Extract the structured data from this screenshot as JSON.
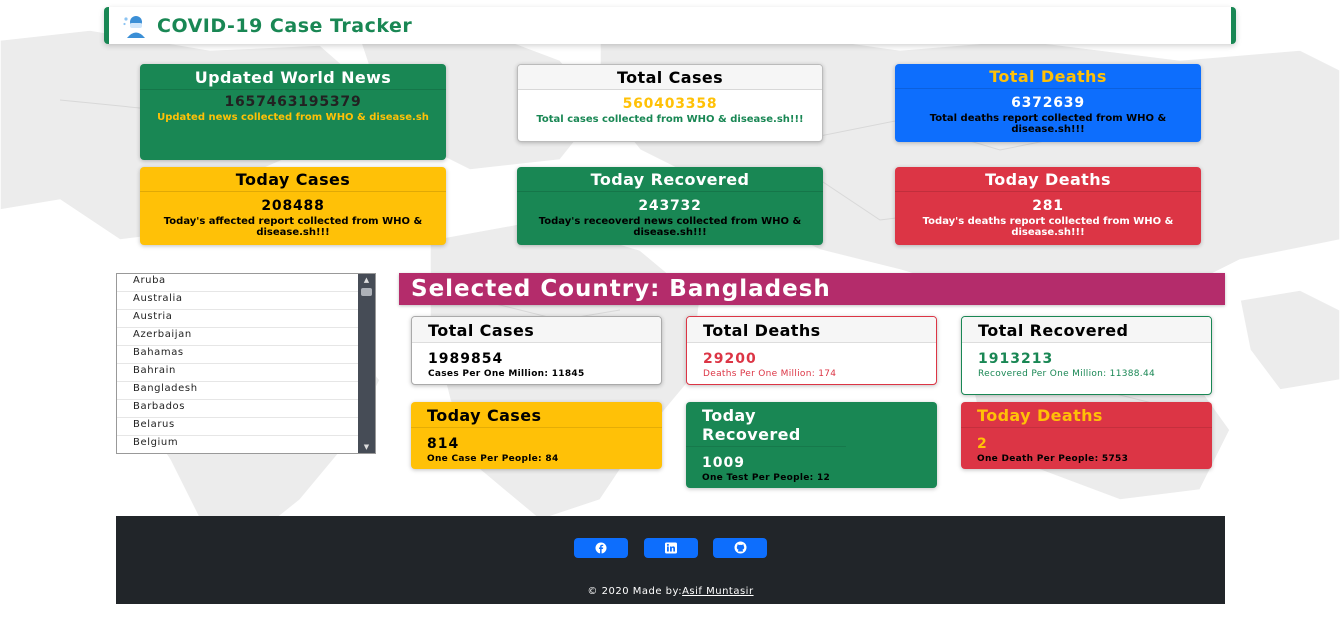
{
  "app": {
    "title": "COVID-19 Case Tracker",
    "accent": "#198754"
  },
  "world": {
    "updated": {
      "title": "Updated World News",
      "value": "1657463195379",
      "note": "Updated news collected from WHO & disease.sh"
    },
    "total_cases": {
      "title": "Total Cases",
      "value": "560403358",
      "note": "Total cases collected from WHO & disease.sh!!!"
    },
    "total_deaths": {
      "title": "Total Deaths",
      "value": "6372639",
      "note": "Total deaths report collected from WHO & disease.sh!!!"
    },
    "today_cases": {
      "title": "Today Cases",
      "value": "208488",
      "note": "Today's affected report collected from WHO & disease.sh!!!"
    },
    "today_recovered": {
      "title": "Today Recovered",
      "value": "243732",
      "note": "Today's receoverd news collected from WHO & disease.sh!!!"
    },
    "today_deaths": {
      "title": "Today Deaths",
      "value": "281",
      "note": "Today's deaths report collected from WHO & disease.sh!!!"
    }
  },
  "countries": [
    "Aruba",
    "Australia",
    "Austria",
    "Azerbaijan",
    "Bahamas",
    "Bahrain",
    "Bangladesh",
    "Barbados",
    "Belarus",
    "Belgium"
  ],
  "selected": {
    "banner": "Selected Country: Bangladesh",
    "total_cases": {
      "title": "Total Cases",
      "value": "1989854",
      "note": "Cases Per One Million: 11845"
    },
    "total_deaths": {
      "title": "Total Deaths",
      "value": "29200",
      "note": "Deaths Per One Million: 174"
    },
    "total_recovered": {
      "title": "Total Recovered",
      "value": "1913213",
      "note": "Recovered Per One Million: 11388.44"
    },
    "today_cases": {
      "title": "Today Cases",
      "value": "814",
      "note": "One Case Per People: 84"
    },
    "today_recovered": {
      "title": "Today Recovered",
      "value": "1009",
      "note": "One Test Per People: 12"
    },
    "today_deaths": {
      "title": "Today Deaths",
      "value": "2",
      "note": "One Death Per People: 5753"
    }
  },
  "footer": {
    "copyright": "© 2020 Made by:",
    "author": "Asif Muntasir",
    "icons": [
      "facebook-icon",
      "linkedin-icon",
      "github-icon"
    ]
  }
}
